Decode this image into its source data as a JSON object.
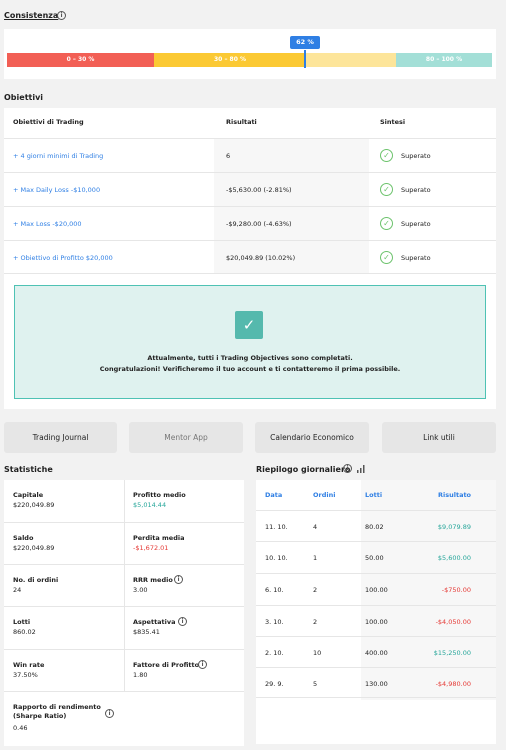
{
  "consistenza": {
    "title": "Consistenza",
    "badge": "62 %",
    "segments": [
      "0 – 30 %",
      "30 – 80 %",
      "",
      "80 – 100 %"
    ]
  },
  "obiettivi": {
    "title": "Obiettivi",
    "headers": [
      "Obiettivi di Trading",
      "Risultati",
      "Sintesi"
    ],
    "rows": [
      {
        "name": "+ 4 giorni minimi di Trading",
        "result": "6",
        "status": "Superato"
      },
      {
        "name": "+ Max Daily Loss -$10,000",
        "result": "-$5,630.00 (-2.81%)",
        "status": "Superato"
      },
      {
        "name": "+ Max Loss -$20,000",
        "result": "-$9,280.00 (-4.63%)",
        "status": "Superato"
      },
      {
        "name": "+ Obiettivo di Profitto $20,000",
        "result": "$20,049.89 (10.02%)",
        "status": "Superato"
      }
    ],
    "congrats_line1": "Attualmente, tutti i Trading Objectives sono completati.",
    "congrats_line2": "Congratulazioni! Verificheremo il tuo account e ti contatteremo il prima possibile."
  },
  "buttons": [
    "Trading Journal",
    "Mentor App",
    "Calendario Economico",
    "Link utili"
  ],
  "statistiche": {
    "title": "Statistiche",
    "items": [
      {
        "label": "Capitale",
        "value": "$220,049.89"
      },
      {
        "label": "Profitto medio",
        "value": "$5,014.44"
      },
      {
        "label": "Saldo",
        "value": "$220,049.89"
      },
      {
        "label": "Perdita media",
        "value": "-$1,672.01"
      },
      {
        "label": "No. di ordini",
        "value": "24"
      },
      {
        "label": "RRR medio",
        "value": "3.00"
      },
      {
        "label": "Lotti",
        "value": "860.02"
      },
      {
        "label": "Aspettativa",
        "value": "$835.41"
      },
      {
        "label": "Win rate",
        "value": "37.50%"
      },
      {
        "label": "Fattore di Profitto",
        "value": "1.80"
      },
      {
        "label": "Rapporto di rendimento (Sharpe Ratio)",
        "value": "0.46"
      }
    ]
  },
  "riepilogo": {
    "title": "Riepilogo giornaliero",
    "headers": [
      "Data",
      "Ordini",
      "Lotti",
      "Risultato"
    ],
    "rows": [
      {
        "data": "11. 10.",
        "ordini": "4",
        "lotti": "80.02",
        "risultato": "$9,079.89"
      },
      {
        "data": "10. 10.",
        "ordini": "1",
        "lotti": "50.00",
        "risultato": "$5,600.00"
      },
      {
        "data": "6. 10.",
        "ordini": "2",
        "lotti": "100.00",
        "risultato": "-$750.00"
      },
      {
        "data": "3. 10.",
        "ordini": "2",
        "lotti": "100.00",
        "risultato": "-$4,050.00"
      },
      {
        "data": "2. 10.",
        "ordini": "10",
        "lotti": "400.00",
        "risultato": "$15,250.00"
      },
      {
        "data": "29. 9.",
        "ordini": "5",
        "lotti": "130.00",
        "risultato": "-$4,980.00"
      }
    ]
  },
  "colors": {
    "red": "#f25f55",
    "yellow": "#fbc934",
    "teal": "#a3dfd7",
    "blue": "#2f7fe4",
    "positive": "#26a69a",
    "negative": "#e53935"
  }
}
